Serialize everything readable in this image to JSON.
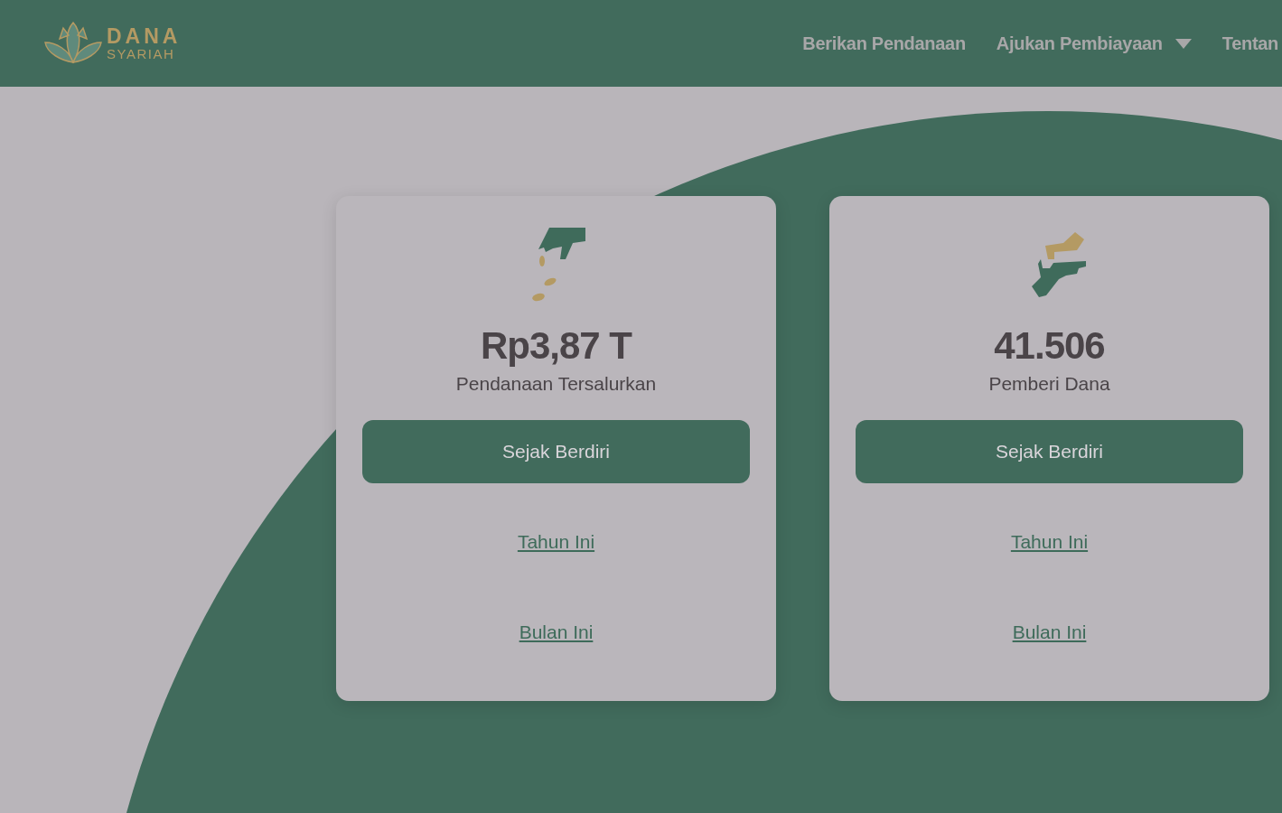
{
  "header": {
    "logo": {
      "line1": "DANA",
      "line2": "SYARIAH"
    },
    "nav": [
      {
        "label": "Berikan Pendanaan",
        "dropdown": false
      },
      {
        "label": "Ajukan Pembiayaan",
        "dropdown": true
      },
      {
        "label": "Tentan",
        "dropdown": false
      }
    ]
  },
  "stats": [
    {
      "kind": "funding",
      "value": "Rp3,87 T",
      "label": "Pendanaan Tersalurkan",
      "periods": [
        {
          "label": "Sejak Berdiri",
          "selected": true
        },
        {
          "label": "Tahun Ini",
          "selected": false
        },
        {
          "label": "Bulan Ini",
          "selected": false
        }
      ]
    },
    {
      "kind": "lenders",
      "value": "41.506",
      "label": "Pemberi Dana",
      "periods": [
        {
          "label": "Sejak Berdiri",
          "selected": true
        },
        {
          "label": "Tahun Ini",
          "selected": false
        },
        {
          "label": "Bulan Ini",
          "selected": false
        }
      ]
    }
  ]
}
